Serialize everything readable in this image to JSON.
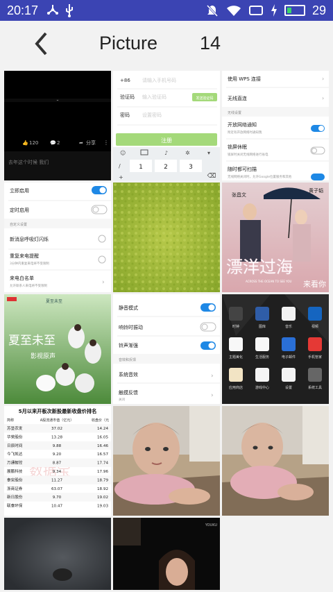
{
  "status": {
    "time": "20:17",
    "battery_level": "29",
    "battery_fraction": 0.29,
    "accent": "#3b44b3"
  },
  "header": {
    "title": "Picture",
    "count": "14"
  },
  "thumbs": {
    "t1": {
      "likes": "120",
      "comments": "2",
      "share": "分享",
      "caption": "去年这个时候 我们"
    },
    "t2": {
      "prefix": "+86",
      "phone_ph": "请输入手机号码",
      "code_label": "验证码",
      "code_ph": "输入验证码",
      "send": "发送验证码",
      "pwd_label": "密码",
      "pwd_ph": "设置密码",
      "submit": "注册",
      "k1": "1",
      "k2": "2",
      "k3": "3",
      "k_slash": "/",
      "k_plus": "+"
    },
    "t3": {
      "wps": "使用 WPS 连接",
      "direct": "无线直连",
      "section": "无线设置",
      "notify": "开放网络通知",
      "notify_sub": "附近有开放网络时通知我",
      "lock": "锁屏休眠",
      "lock_sub": "锁屏时关闭无线网络进行省电",
      "scan": "随时都可扫描",
      "scan_sub": "无线网络关闭时，允许Google位置服务和其他"
    },
    "t4": {
      "immediate": "立即启用",
      "timed": "定时启用",
      "section": "自定义设置",
      "breath": "新消息呼吸灯闪烁",
      "repeat": "重复来电提醒",
      "repeat_sub": "3分钟内重复来电将不受限制",
      "whitelist": "来电白名单",
      "whitelist_sub": "允许联系人来电将不受限制"
    },
    "t6": {
      "name_left": "张昌文",
      "name_right": "黄子韬",
      "big": "漂洋过海",
      "sub": "来看你",
      "eng": "ACROSS THE OCEAN TO SEE YOU"
    },
    "t7": {
      "tag": "夏至未至",
      "title": "夏至未至",
      "sub": "影视原声"
    },
    "t8": {
      "silent": "静音模式",
      "vibrate": "响铃时振动",
      "fade": "铃声渐强",
      "section": "音效和反馈",
      "sound": "系统音效",
      "haptic": "触摸反馈",
      "haptic_sub": "关闭"
    },
    "t9": {
      "apps": [
        "时钟",
        "图库",
        "音乐",
        "视频",
        "主题美化",
        "生活服务",
        "电子邮件",
        "手机管家",
        "应用商店",
        "游戏中心",
        "设置",
        "系统工具"
      ]
    },
    "t10": {
      "title": "5月以来开板次新股最新收盘价排名",
      "h1": "简称",
      "h2": "A股流通市值（亿元）",
      "h3": "收盘价（元",
      "rows": [
        [
          "苏垦农发",
          "37.02",
          "14.24"
        ],
        [
          "华荣股份",
          "13.28",
          "16.05"
        ],
        [
          "日辰时间",
          "9.88",
          "16.46"
        ],
        [
          "今飞凯达",
          "9.20",
          "16.57"
        ],
        [
          "万通智控",
          "8.87",
          "17.74"
        ],
        [
          "展鹏科技",
          "9.34",
          "17.96"
        ],
        [
          "泰安股份",
          "11.27",
          "18.79"
        ],
        [
          "浙商证券",
          "63.07",
          "18.92"
        ],
        [
          "新日股份",
          "9.70",
          "19.02"
        ],
        [
          "联泰环保",
          "10.47",
          "19.03"
        ]
      ],
      "watermark": "数据宝"
    },
    "t14": {
      "brand": "YOUKU"
    }
  }
}
